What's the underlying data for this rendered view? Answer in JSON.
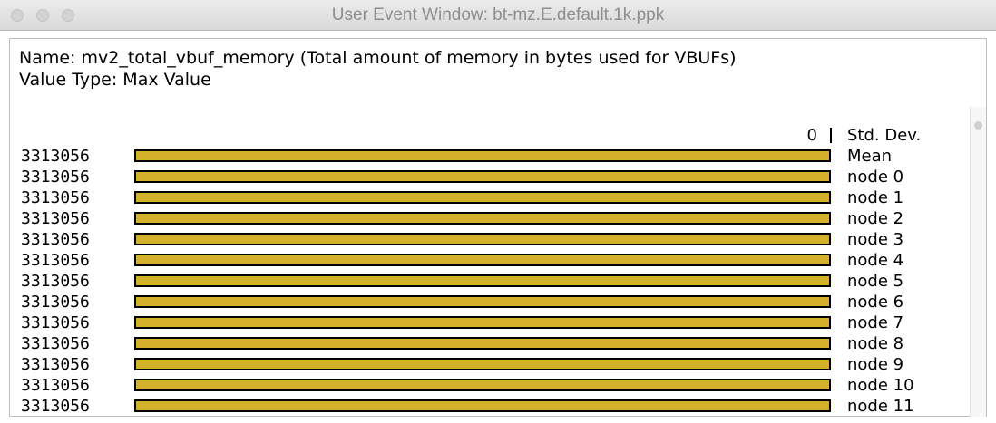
{
  "window": {
    "title": "User Event Window: bt-mz.E.default.1k.ppk"
  },
  "info": {
    "name_line": "Name: mv2_total_vbuf_memory (Total amount of memory in bytes used for VBUFs)",
    "value_type_line": "Value Type: Max Value"
  },
  "header": {
    "value": "0",
    "label": "Std. Dev."
  },
  "bar_color": "#d4b12a",
  "chart_data": {
    "type": "bar",
    "categories": [
      "Mean",
      "node 0",
      "node 1",
      "node 2",
      "node 3",
      "node 4",
      "node 5",
      "node 6",
      "node 7",
      "node 8",
      "node 9",
      "node 10",
      "node 11"
    ],
    "values": [
      3313056,
      3313056,
      3313056,
      3313056,
      3313056,
      3313056,
      3313056,
      3313056,
      3313056,
      3313056,
      3313056,
      3313056,
      3313056
    ],
    "value_labels": [
      "3313056",
      "3313056",
      "3313056",
      "3313056",
      "3313056",
      "3313056",
      "3313056",
      "3313056",
      "3313056",
      "3313056",
      "3313056",
      "3313056",
      "3313056"
    ],
    "std_dev": 0,
    "xlim": [
      0,
      3313056
    ]
  }
}
